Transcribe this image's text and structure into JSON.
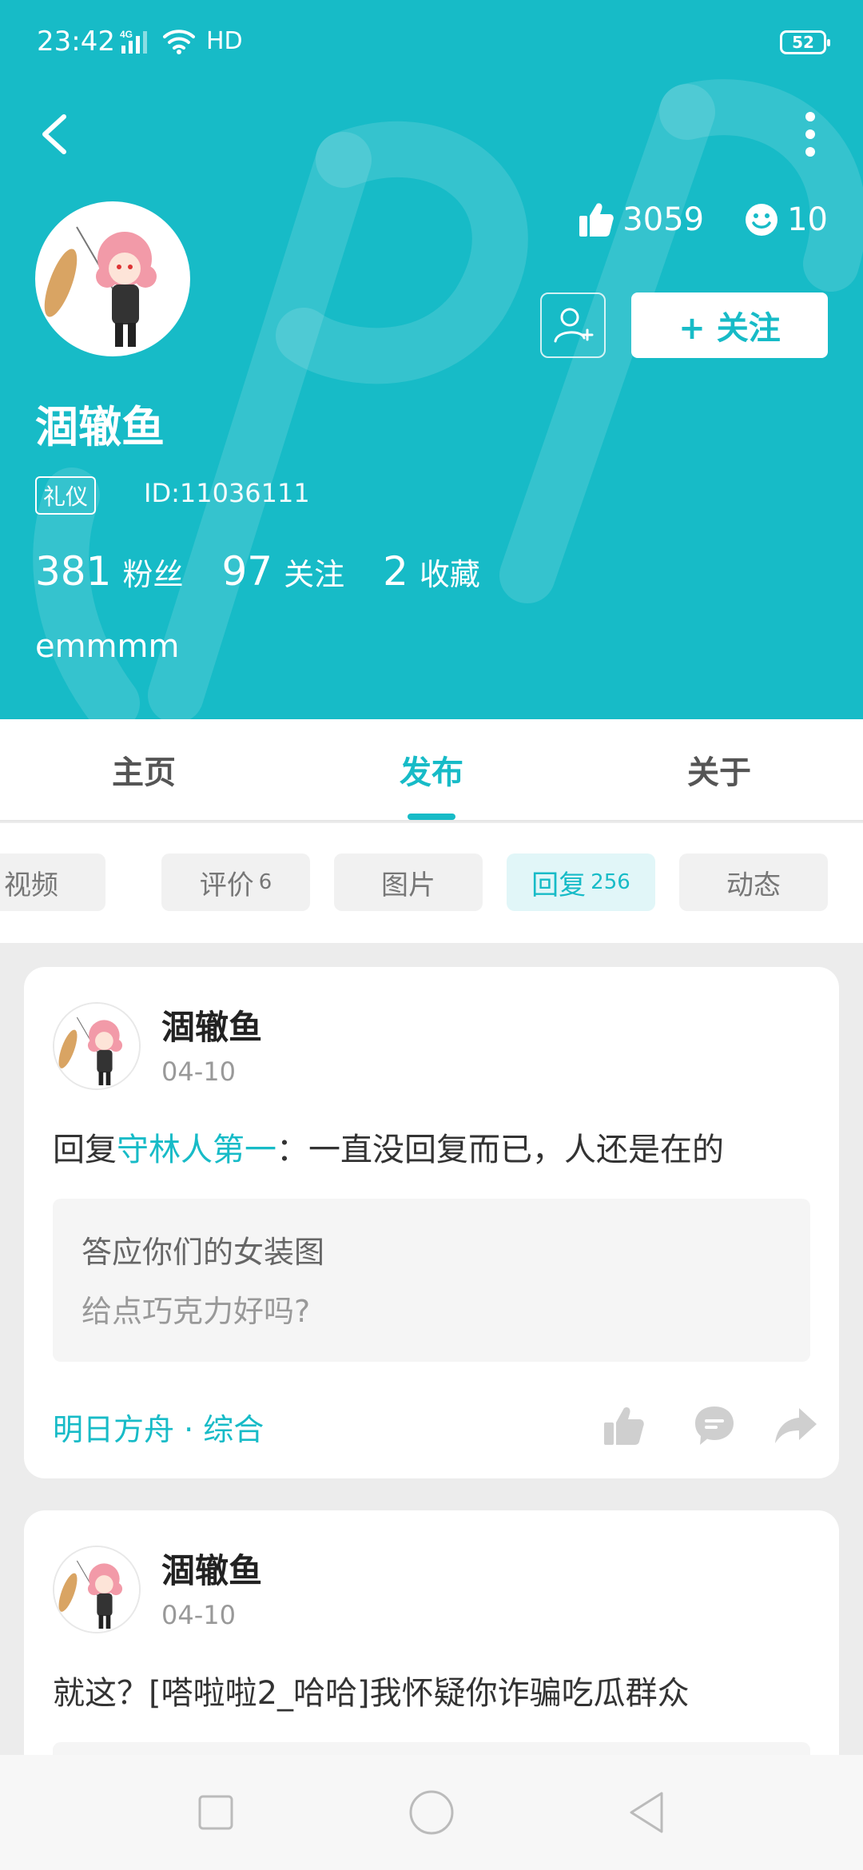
{
  "status_bar": {
    "time": "23:42",
    "network": "4G",
    "hd": "HD",
    "battery": "52"
  },
  "profile": {
    "name": "涸辙鱼",
    "badge": "礼仪",
    "id_text": "ID:11036111",
    "likes": "3059",
    "smiles": "10",
    "follow_label": "+ 关注",
    "fans_count": "381",
    "fans_label": "粉丝",
    "following_count": "97",
    "following_label": "关注",
    "fav_count": "2",
    "fav_label": "收藏",
    "bio": "emmmm"
  },
  "colors": {
    "accent": "#17bbc7"
  },
  "tabs": [
    {
      "label": "主页",
      "active": false
    },
    {
      "label": "发布",
      "active": true
    },
    {
      "label": "关于",
      "active": false
    }
  ],
  "chips": [
    {
      "label": "视频",
      "count": ""
    },
    {
      "label": "评价",
      "count": "6"
    },
    {
      "label": "图片",
      "count": ""
    },
    {
      "label": "回复",
      "count": "256"
    },
    {
      "label": "动态",
      "count": ""
    }
  ],
  "posts": [
    {
      "name": "涸辙鱼",
      "date": "04-10",
      "prefix": "回复",
      "reply_to": "守林人第一",
      "text": "：一直没回复而已，人还是在的",
      "quote_title": "答应你们的女装图",
      "quote_sub": "给点巧克力好吗?",
      "source": "明日方舟 · 综合"
    },
    {
      "name": "涸辙鱼",
      "date": "04-10",
      "text": "就这？[嗒啦啦2_哈哈]我怀疑你诈骗吃瓜群众"
    }
  ]
}
